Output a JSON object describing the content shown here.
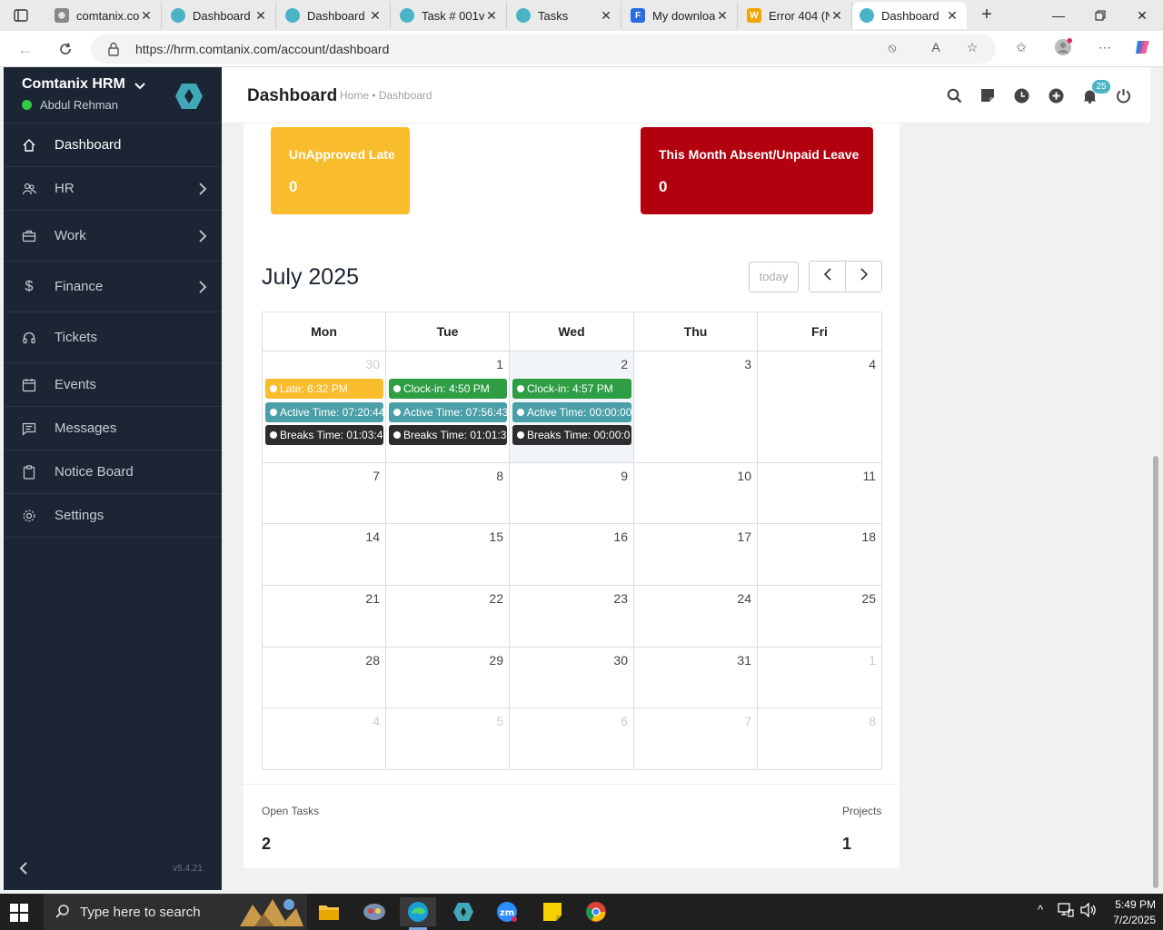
{
  "browser": {
    "tabs": [
      {
        "title": "comtanix.co",
        "color": "#777"
      },
      {
        "title": "Dashboard",
        "color": "#4ab4c6"
      },
      {
        "title": "Dashboard",
        "color": "#4ab4c6"
      },
      {
        "title": "Task # 001v",
        "color": "#4ab4c6"
      },
      {
        "title": "Tasks",
        "color": "#4ab4c6"
      },
      {
        "title": "My downloa",
        "color": "#2b6de0"
      },
      {
        "title": "Error 404 (N",
        "color": "#f0a500"
      },
      {
        "title": "Dashboard",
        "color": "#4ab4c6"
      }
    ],
    "active_tab_index": 7,
    "url": "https://hrm.comtanix.com/account/dashboard"
  },
  "sidebar": {
    "company": "Comtanix HRM",
    "user": "Abdul Rehman",
    "status_color": "#2ecc40",
    "items": [
      {
        "label": "Dashboard",
        "icon": "home-icon",
        "has_arrow": false
      },
      {
        "label": "HR",
        "icon": "people-icon",
        "has_arrow": true
      },
      {
        "label": "Work",
        "icon": "briefcase-icon",
        "has_arrow": true
      },
      {
        "label": "Finance",
        "icon": "dollar-icon",
        "has_arrow": true
      },
      {
        "label": "Tickets",
        "icon": "headset-icon",
        "has_arrow": false
      },
      {
        "label": "Events",
        "icon": "calendar-icon",
        "has_arrow": false
      },
      {
        "label": "Messages",
        "icon": "message-icon",
        "has_arrow": false
      },
      {
        "label": "Notice Board",
        "icon": "clipboard-icon",
        "has_arrow": false
      },
      {
        "label": "Settings",
        "icon": "gear-icon",
        "has_arrow": false
      }
    ],
    "version": "v5.4.21"
  },
  "header": {
    "title": "Dashboard",
    "breadcrumb": "Home • Dashboard",
    "notification_count": "25"
  },
  "cards": [
    {
      "title": "UnApproved Late",
      "value": "0",
      "color": "#f9bc2c"
    },
    {
      "title": "This Month Absent/Unpaid Leave",
      "value": "0",
      "color": "#b3000f"
    }
  ],
  "calendar": {
    "month_title": "July 2025",
    "today_label": "today",
    "days_of_week": [
      "Mon",
      "Tue",
      "Wed",
      "Thu",
      "Fri"
    ],
    "weeks": [
      [
        "30",
        "1",
        "2",
        "3",
        "4"
      ],
      [
        "7",
        "8",
        "9",
        "10",
        "11"
      ],
      [
        "14",
        "15",
        "16",
        "17",
        "18"
      ],
      [
        "21",
        "22",
        "23",
        "24",
        "25"
      ],
      [
        "28",
        "29",
        "30",
        "31",
        "1"
      ],
      [
        "4",
        "5",
        "6",
        "7",
        "8"
      ]
    ],
    "events": {
      "mon": [
        {
          "text": "Late: 6:32 PM",
          "color": "#f9bc2c"
        },
        {
          "text": "Active Time: 07:20:44",
          "color": "#4a9fa8"
        },
        {
          "text": "Breaks Time: 01:03:4",
          "color": "#2d2d2d"
        }
      ],
      "tue": [
        {
          "text": "Clock-in: 4:50 PM",
          "color": "#2e9e45"
        },
        {
          "text": "Active Time: 07:56:43",
          "color": "#4a9fa8"
        },
        {
          "text": "Breaks Time: 01:01:3",
          "color": "#2d2d2d"
        }
      ],
      "wed": [
        {
          "text": "Clock-in: 4:57 PM",
          "color": "#2e9e45"
        },
        {
          "text": "Active Time: 00:00:00",
          "color": "#4a9fa8"
        },
        {
          "text": "Breaks Time: 00:00:0",
          "color": "#2d2d2d"
        }
      ]
    }
  },
  "stats": {
    "open_tasks_label": "Open Tasks",
    "open_tasks_value": "2",
    "projects_label": "Projects",
    "projects_value": "1"
  },
  "taskbar": {
    "search_placeholder": "Type here to search",
    "time": "5:49 PM",
    "date": "7/2/2025"
  }
}
